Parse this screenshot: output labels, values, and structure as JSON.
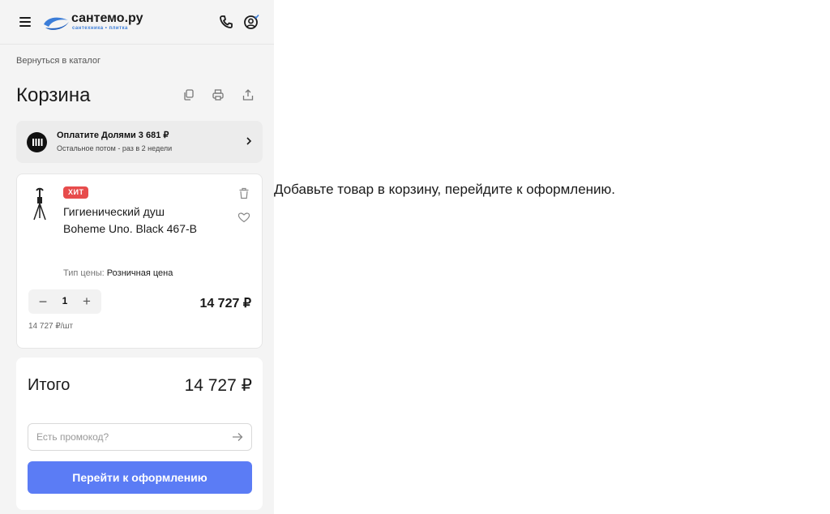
{
  "header": {
    "logo_name": "сантемо.ру",
    "logo_sub": "сантехника • плитка",
    "menu_icon": "hamburger-icon",
    "phone_icon": "phone-icon",
    "account_icon": "user-account-icon"
  },
  "nav": {
    "back_label": "Вернуться в каталог"
  },
  "cart": {
    "title": "Корзина",
    "title_icons": [
      "copy-icon",
      "print-icon",
      "share-icon"
    ]
  },
  "dolyami": {
    "title": "Оплатите Долями 3 681 ₽",
    "subtitle": "Остальное потом - раз в 2 недели"
  },
  "item": {
    "badge": "ХИТ",
    "name": "Гигиенический душ Boheme Uno. Black 467-B",
    "price_type_label": "Тип цены:",
    "price_type_value": "Розничная цена",
    "quantity": "1",
    "price": "14 727 ₽",
    "unit_price": "14 727 ₽/шт"
  },
  "summary": {
    "total_label": "Итого",
    "total_value": "14 727 ₽",
    "promo_placeholder": "Есть промокод?",
    "checkout_label": "Перейти к оформлению"
  },
  "hint": "Добавьте товар в корзину, перейдите к оформлению.",
  "colors": {
    "accent": "#5b7cf5",
    "badge": "#e74c4c",
    "logo_blue": "#3b7dd8"
  }
}
